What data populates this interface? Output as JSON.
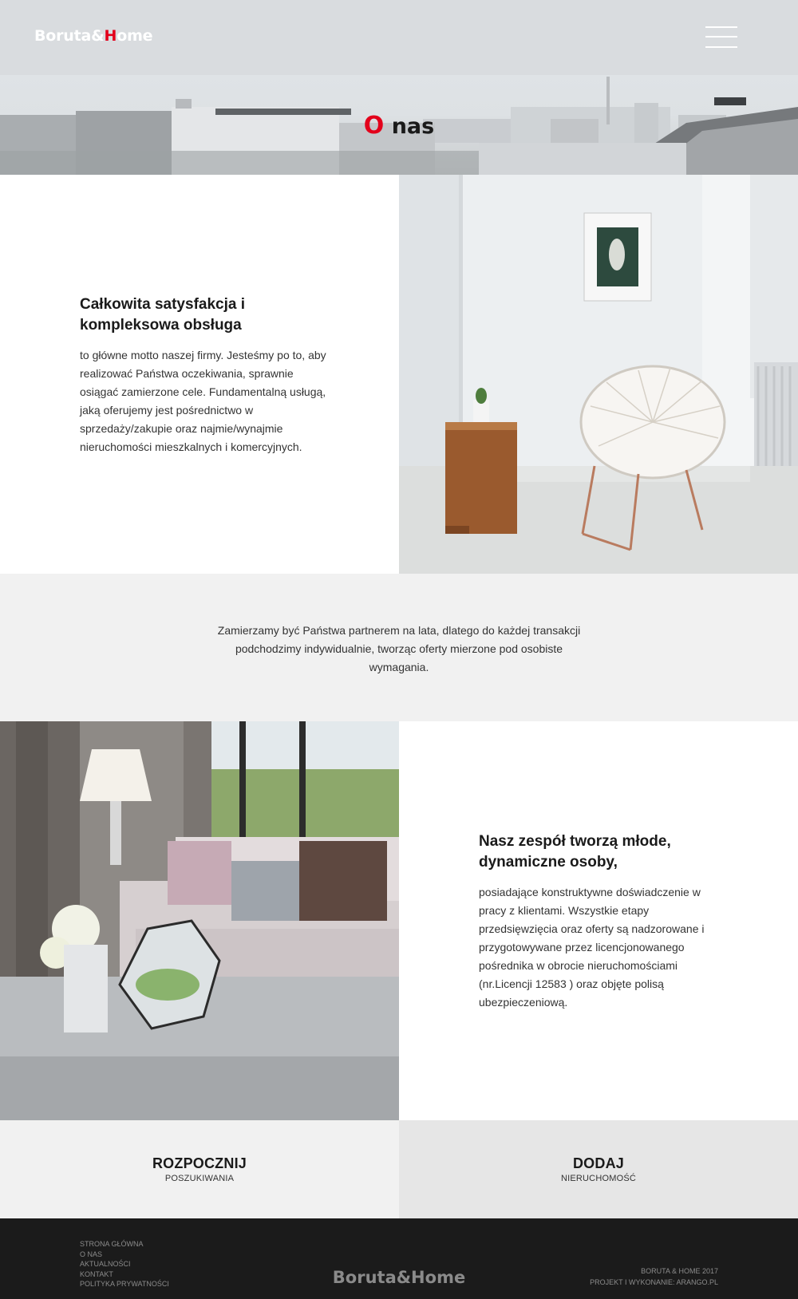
{
  "header": {
    "logo": {
      "part1": "Boruta",
      "amp": "&",
      "h": "H",
      "part2": "ome"
    },
    "menu_icon": "hamburger-menu-icon"
  },
  "hero": {
    "title_first": "O",
    "title_rest": " nas"
  },
  "section1": {
    "heading": "Całkowita satysfakcja i kompleksowa obsługa",
    "body": "to główne motto naszej firmy. Jesteśmy po to, aby realizować Państwa oczekiwania, sprawnie osiągać zamierzone cele. Fundamentalną usługą, jaką oferujemy jest pośrednictwo w sprzedaży/zakupie oraz najmie/wynajmie nieruchomości mieszkalnych i komercyjnych."
  },
  "band": {
    "text": "Zamierzamy być Państwa partnerem na lata, dlatego do każdej transakcji podchodzimy indywidualnie, tworząc oferty mierzone pod osobiste wymagania."
  },
  "section2": {
    "heading": "Nasz zespół tworzą młode, dynamiczne osoby,",
    "body": "posiadające konstruktywne doświadczenie w pracy z klientami. Wszystkie etapy przedsięwzięcia oraz oferty są nadzorowane i przygotowywane przez licencjonowanego pośrednika w obrocie nieruchomościami (nr.Licencji 12583  ) oraz objęte polisą ubezpieczeniową."
  },
  "cta": {
    "left": {
      "main": "ROZPOCZNIJ",
      "sub": "POSZUKIWANIA"
    },
    "right": {
      "main": "DODAJ",
      "sub": "NIERUCHOMOŚĆ"
    }
  },
  "footer": {
    "nav": [
      "STRONA GŁÓWNA",
      "O NAS",
      "AKTUALNOŚCI",
      "KONTAKT",
      "POLITYKA PRYWATNOŚCI"
    ],
    "logo": "Boruta&Home",
    "copyright": "BORUTA & HOME 2017",
    "credits": "PROJEKT I WYKONANIE: ARANGO.PL"
  },
  "colors": {
    "accent": "#e3001b",
    "header_bg": "#d9dcdf",
    "band_bg": "#f1f1f1",
    "footer_bg": "#1b1b1b"
  }
}
